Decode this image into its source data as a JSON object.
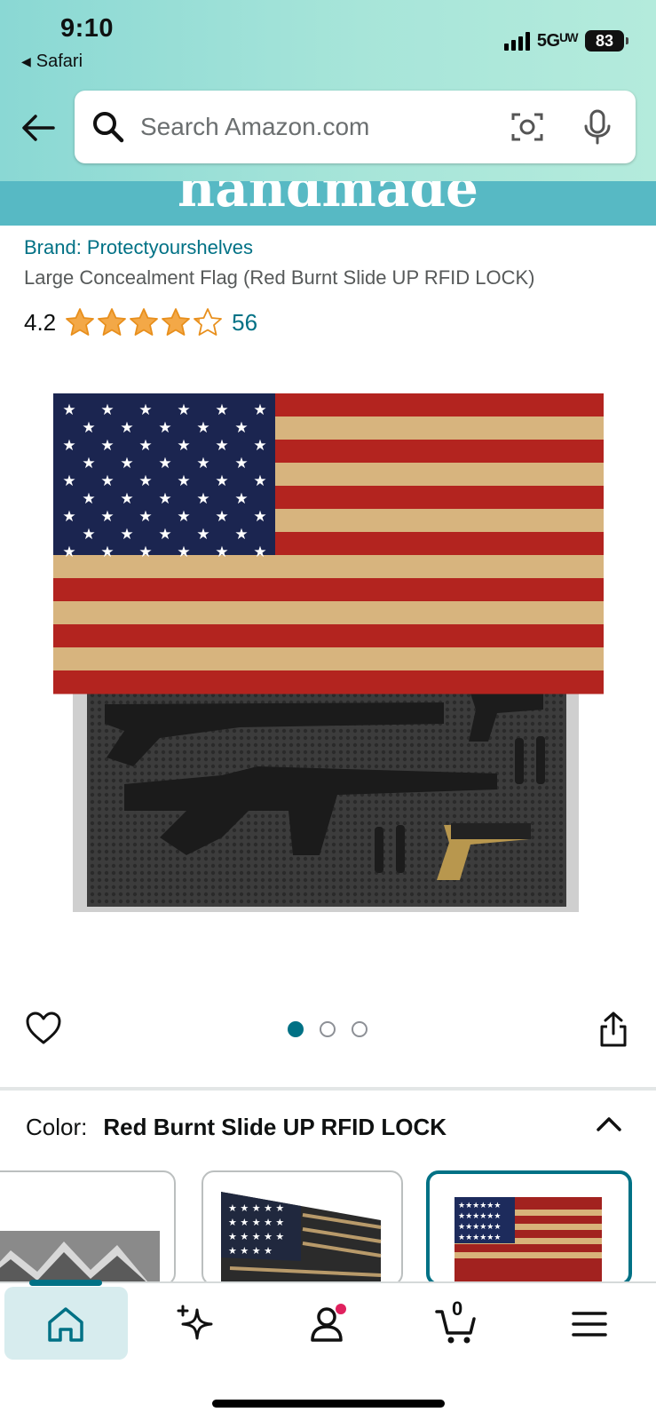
{
  "status_bar": {
    "time": "9:10",
    "back_app": "Safari",
    "network": "5Gᵁᵂ",
    "battery": "83"
  },
  "search": {
    "placeholder": "Search Amazon.com"
  },
  "banner": {
    "text": "handmade"
  },
  "product": {
    "brand": "Brand: Protectyourshelves",
    "title": "Large Concealment Flag (Red Burnt Slide UP RFID LOCK)",
    "rating": "4.2",
    "rating_value": 4.2,
    "rating_max": 5,
    "review_count": "56"
  },
  "gallery": {
    "image_count": 3,
    "active_index": 0
  },
  "color": {
    "label": "Color:",
    "value": "Red Burnt Slide UP RFID LOCK"
  },
  "bottom_nav": {
    "items": [
      "home-icon",
      "ai-sparkle-icon",
      "account-icon",
      "cart-icon",
      "menu-icon"
    ],
    "cart_count": "0"
  },
  "colors": {
    "amazon_teal": "#007185",
    "star": "#f3a847",
    "banner": "#57b9c4"
  }
}
